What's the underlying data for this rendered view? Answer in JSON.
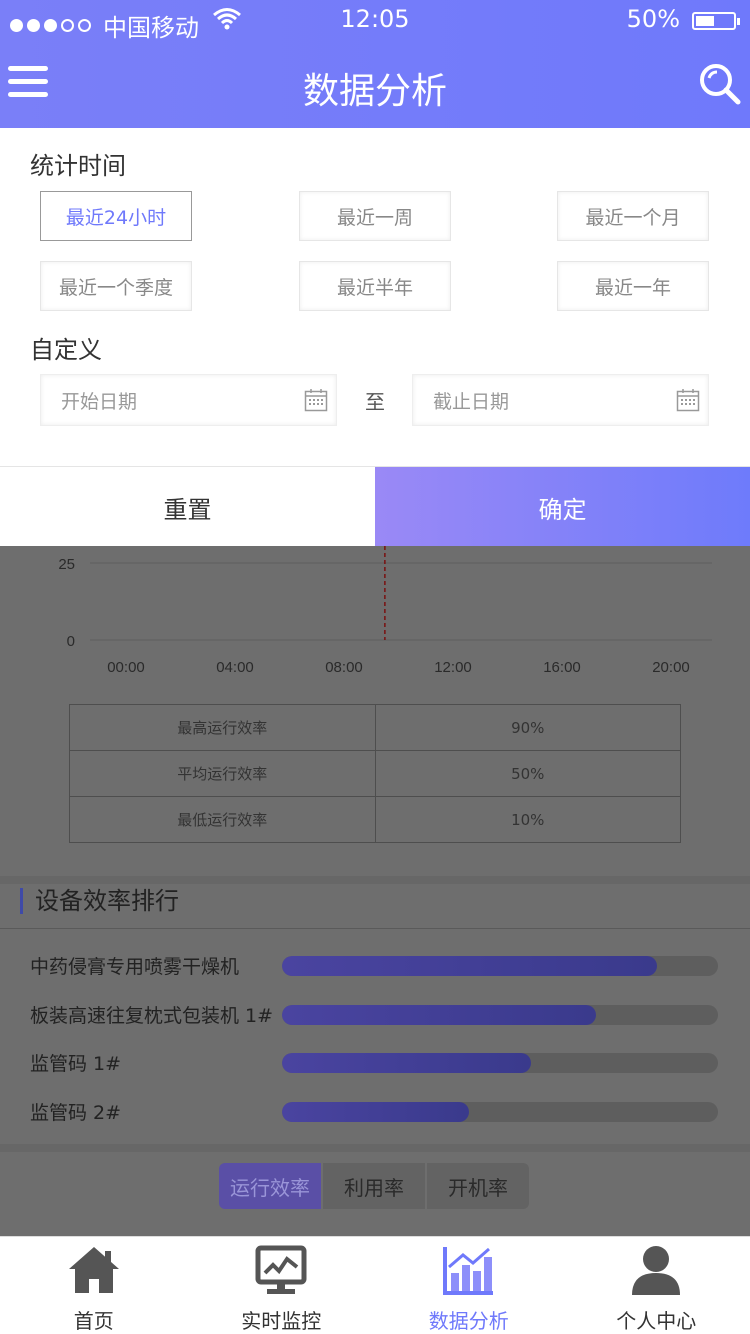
{
  "status_bar": {
    "carrier": "中国移动",
    "time": "12:05",
    "battery": "50%",
    "battery_level": 0.5
  },
  "nav": {
    "title": "数据分析",
    "menu_icon": "hamburger-menu-icon",
    "search_icon": "search-icon"
  },
  "filter": {
    "stat_time_title": "统计时间",
    "options": [
      "最近24小时",
      "最近一周",
      "最近一个月",
      "最近一个季度",
      "最近半年",
      "最近一年"
    ],
    "selected_option": "最近24小时",
    "custom_title": "自定义",
    "start_placeholder": "开始日期",
    "to_label": "至",
    "end_placeholder": "截止日期",
    "reset_label": "重置",
    "confirm_label": "确定"
  },
  "chart_data": {
    "type": "line",
    "y_ticks": [
      "25",
      "0"
    ],
    "x_ticks": [
      "00:00",
      "04:00",
      "08:00",
      "12:00",
      "16:00",
      "20:00"
    ],
    "marker_time": "09:30"
  },
  "stats_table": [
    {
      "label": "最高运行效率",
      "value": "90%"
    },
    {
      "label": "平均运行效率",
      "value": "50%"
    },
    {
      "label": "最低运行效率",
      "value": "10%"
    }
  ],
  "ranking": {
    "title": "设备效率排行",
    "items": [
      {
        "name": "中药侵膏专用喷雾干燥机",
        "fraction": 0.86
      },
      {
        "name": "板装高速往复枕式包装机 1#",
        "fraction": 0.72
      },
      {
        "name": "监管码 1#",
        "fraction": 0.57
      },
      {
        "name": "监管码 2#",
        "fraction": 0.43
      }
    ]
  },
  "metric_tabs": [
    "运行效率",
    "利用率",
    "开机率"
  ],
  "tab_bar": [
    {
      "label": "首页",
      "icon": "home-icon"
    },
    {
      "label": "实时监控",
      "icon": "monitor-icon"
    },
    {
      "label": "数据分析",
      "icon": "bar-chart-icon"
    },
    {
      "label": "个人中心",
      "icon": "user-icon"
    }
  ],
  "colors": {
    "accent": "#6f79fb",
    "confirm_gradient_start": "#9a89f6",
    "overlay": "#6e6e6e"
  }
}
